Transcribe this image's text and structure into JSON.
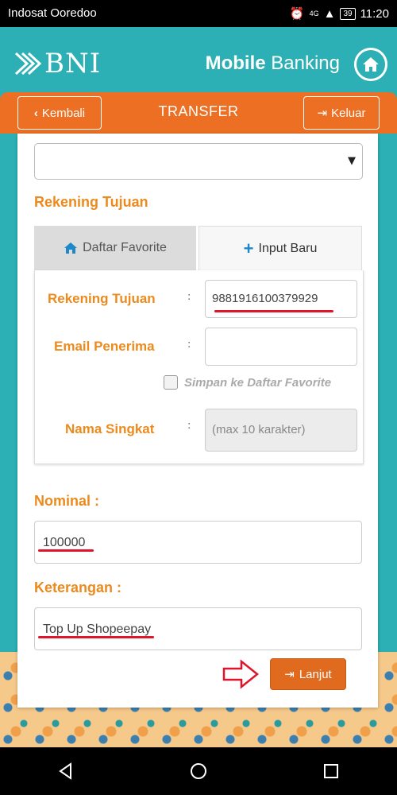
{
  "status": {
    "carrier": "Indosat Ooredoo",
    "network": "4G",
    "battery": "39",
    "time": "11:20"
  },
  "header": {
    "logo_text": "BNI",
    "title_bold": "Mobile",
    "title_rest": " Banking"
  },
  "nav": {
    "back_label": "Kembali",
    "title": "TRANSFER",
    "exit_label": "Keluar"
  },
  "form": {
    "source_account_value": "",
    "dest_section_label": "Rekening Tujuan",
    "tabs": [
      {
        "label": "Daftar Favorite"
      },
      {
        "label": "Input Baru"
      }
    ],
    "dest_account": {
      "label": "Rekening Tujuan",
      "colon": ":",
      "value": "9881916100379929"
    },
    "email": {
      "label": "Email Penerima",
      "colon": ":",
      "value": ""
    },
    "save_favorite_label": "Simpan ke Daftar Favorite",
    "nickname": {
      "label": "Nama Singkat",
      "colon": ":",
      "placeholder": "(max 10 karakter)"
    },
    "amount_label": "Nominal :",
    "amount_value": "100000",
    "note_label": "Keterangan :",
    "note_value": "Top Up Shopeepay",
    "next_label": "Lanjut"
  },
  "colors": {
    "teal": "#2cb0b5",
    "orange": "#ec6f23",
    "label_orange": "#ec8a1d",
    "annotation_red": "#e0142b"
  }
}
